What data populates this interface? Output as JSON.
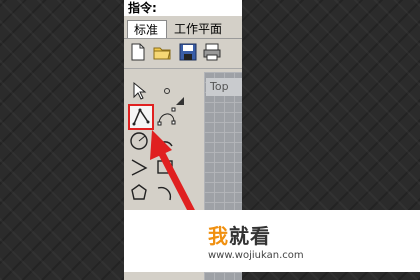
{
  "command_bar": {
    "label": "指令:"
  },
  "tabs": [
    {
      "label": "标准",
      "active": true
    },
    {
      "label": "工作平面",
      "active": false
    }
  ],
  "toolbar_icons": [
    "new-file-icon",
    "open-folder-icon",
    "save-icon",
    "print-icon"
  ],
  "viewport": {
    "label": "Top"
  },
  "selected_tool": "polyline-tool",
  "annotation": {
    "color": "#e02020",
    "shape": "arrow"
  },
  "watermark": {
    "logo_accent": "我",
    "logo_text": "就看",
    "url": "www.wojiukan.com"
  }
}
